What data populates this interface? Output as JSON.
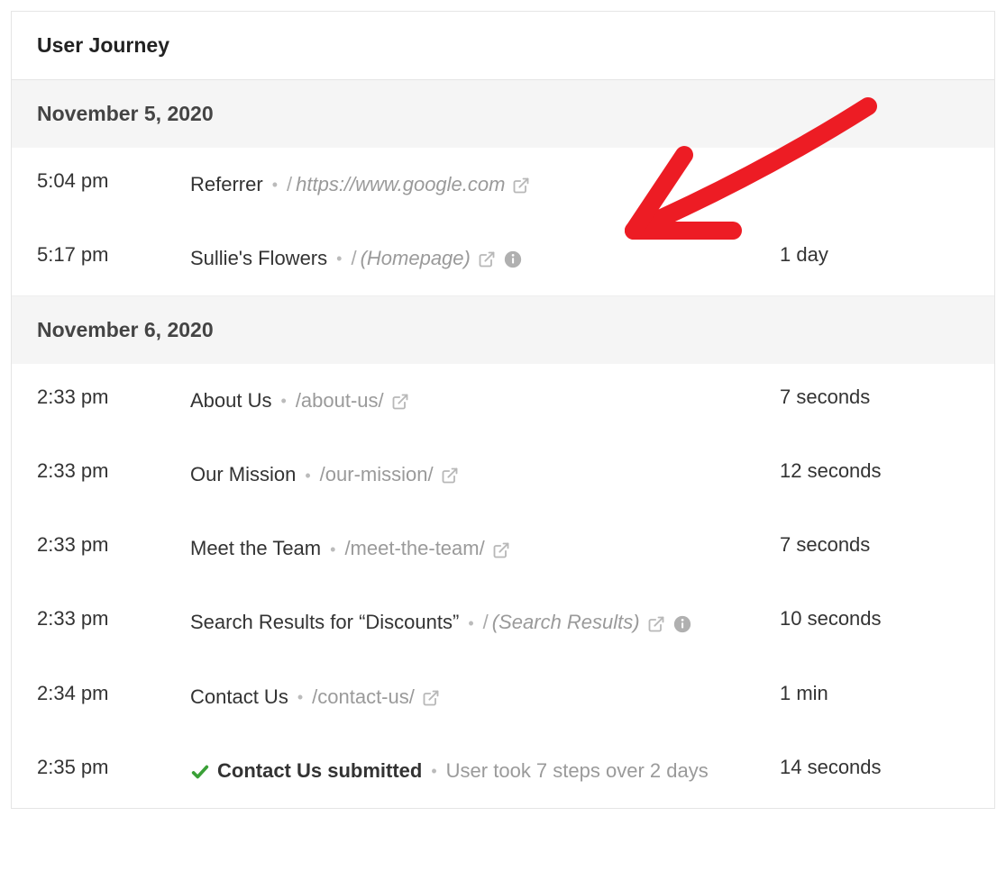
{
  "header": {
    "title": "User Journey"
  },
  "groups": [
    {
      "date": "November 5, 2020",
      "rows": [
        {
          "time": "5:04 pm",
          "title": "Referrer",
          "title_bold": false,
          "path": "https://www.google.com",
          "path_italic": true,
          "show_slash": true,
          "external_link": true,
          "info_icon": false,
          "check_icon": false,
          "meta": "",
          "duration": "",
          "arrow_annotation": false
        },
        {
          "time": "5:17 pm",
          "title": "Sullie's Flowers",
          "title_bold": false,
          "path": "(Homepage)",
          "path_italic": true,
          "show_slash": true,
          "external_link": true,
          "info_icon": true,
          "check_icon": false,
          "meta": "",
          "duration": "1 day",
          "arrow_annotation": true
        }
      ]
    },
    {
      "date": "November 6, 2020",
      "rows": [
        {
          "time": "2:33 pm",
          "title": "About Us",
          "title_bold": false,
          "path": "/about-us/",
          "path_italic": false,
          "show_slash": false,
          "external_link": true,
          "info_icon": false,
          "check_icon": false,
          "meta": "",
          "duration": "7 seconds",
          "arrow_annotation": false
        },
        {
          "time": "2:33 pm",
          "title": "Our Mission",
          "title_bold": false,
          "path": "/our-mission/",
          "path_italic": false,
          "show_slash": false,
          "external_link": true,
          "info_icon": false,
          "check_icon": false,
          "meta": "",
          "duration": "12 seconds",
          "arrow_annotation": false
        },
        {
          "time": "2:33 pm",
          "title": "Meet the Team",
          "title_bold": false,
          "path": "/meet-the-team/",
          "path_italic": false,
          "show_slash": false,
          "external_link": true,
          "info_icon": false,
          "check_icon": false,
          "meta": "",
          "duration": "7 seconds",
          "arrow_annotation": false
        },
        {
          "time": "2:33 pm",
          "title": "Search Results for “Discounts”",
          "title_bold": false,
          "path": "(Search Results)",
          "path_italic": true,
          "show_slash": true,
          "external_link": true,
          "info_icon": true,
          "check_icon": false,
          "meta": "",
          "duration": "10 seconds",
          "arrow_annotation": false
        },
        {
          "time": "2:34 pm",
          "title": "Contact Us",
          "title_bold": false,
          "path": "/contact-us/",
          "path_italic": false,
          "show_slash": false,
          "external_link": true,
          "info_icon": false,
          "check_icon": false,
          "meta": "",
          "duration": "1 min",
          "arrow_annotation": false
        },
        {
          "time": "2:35 pm",
          "title": "Contact Us submitted",
          "title_bold": true,
          "path": "",
          "path_italic": false,
          "show_slash": false,
          "external_link": false,
          "info_icon": false,
          "check_icon": true,
          "meta": "User took 7 steps over 2 days",
          "duration": "14 seconds",
          "arrow_annotation": false
        }
      ]
    }
  ]
}
